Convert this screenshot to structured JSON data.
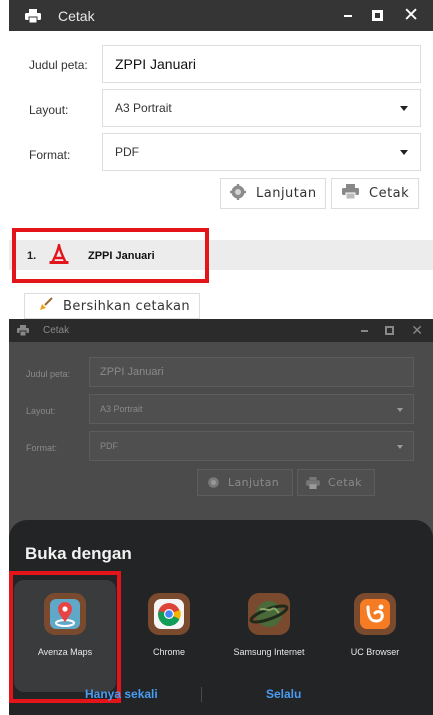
{
  "dialog": {
    "title": "Cetak",
    "fields": {
      "map_title": {
        "label": "Judul peta:",
        "value": "ZPPI Januari"
      },
      "layout": {
        "label": "Layout:",
        "value": "A3 Portrait"
      },
      "format": {
        "label": "Format:",
        "value": "PDF"
      }
    },
    "buttons": {
      "advanced": "Lanjutan",
      "print": "Cetak"
    }
  },
  "results": {
    "items": [
      {
        "index": "1.",
        "name": "ZPPI Januari",
        "type_icon": "pdf-icon"
      }
    ],
    "clear_label": "Bersihkan cetakan"
  },
  "background_dialog": {
    "title": "Cetak",
    "fields": {
      "map_title": {
        "label": "Judul peta:",
        "value": "ZPPI Januari"
      },
      "layout": {
        "label": "Layout:",
        "value": "A3 Portrait"
      },
      "format": {
        "label": "Format:",
        "value": "PDF"
      }
    },
    "buttons": {
      "advanced": "Lanjutan",
      "print": "Cetak"
    }
  },
  "open_with": {
    "title": "Buka dengan",
    "apps": [
      {
        "name": "Avenza Maps",
        "icon": "avenza-maps-icon",
        "selected": true
      },
      {
        "name": "Chrome",
        "icon": "chrome-icon",
        "selected": false
      },
      {
        "name": "Samsung Internet",
        "icon": "samsung-internet-icon",
        "selected": false
      },
      {
        "name": "UC Browser",
        "icon": "uc-browser-icon",
        "selected": false
      }
    ],
    "actions": {
      "once": "Hanya sekali",
      "always": "Selalu"
    }
  },
  "colors": {
    "highlight": "#e4141b",
    "action_text": "#4a9cf2",
    "titlebar": "#353535",
    "sheet": "#232425"
  }
}
